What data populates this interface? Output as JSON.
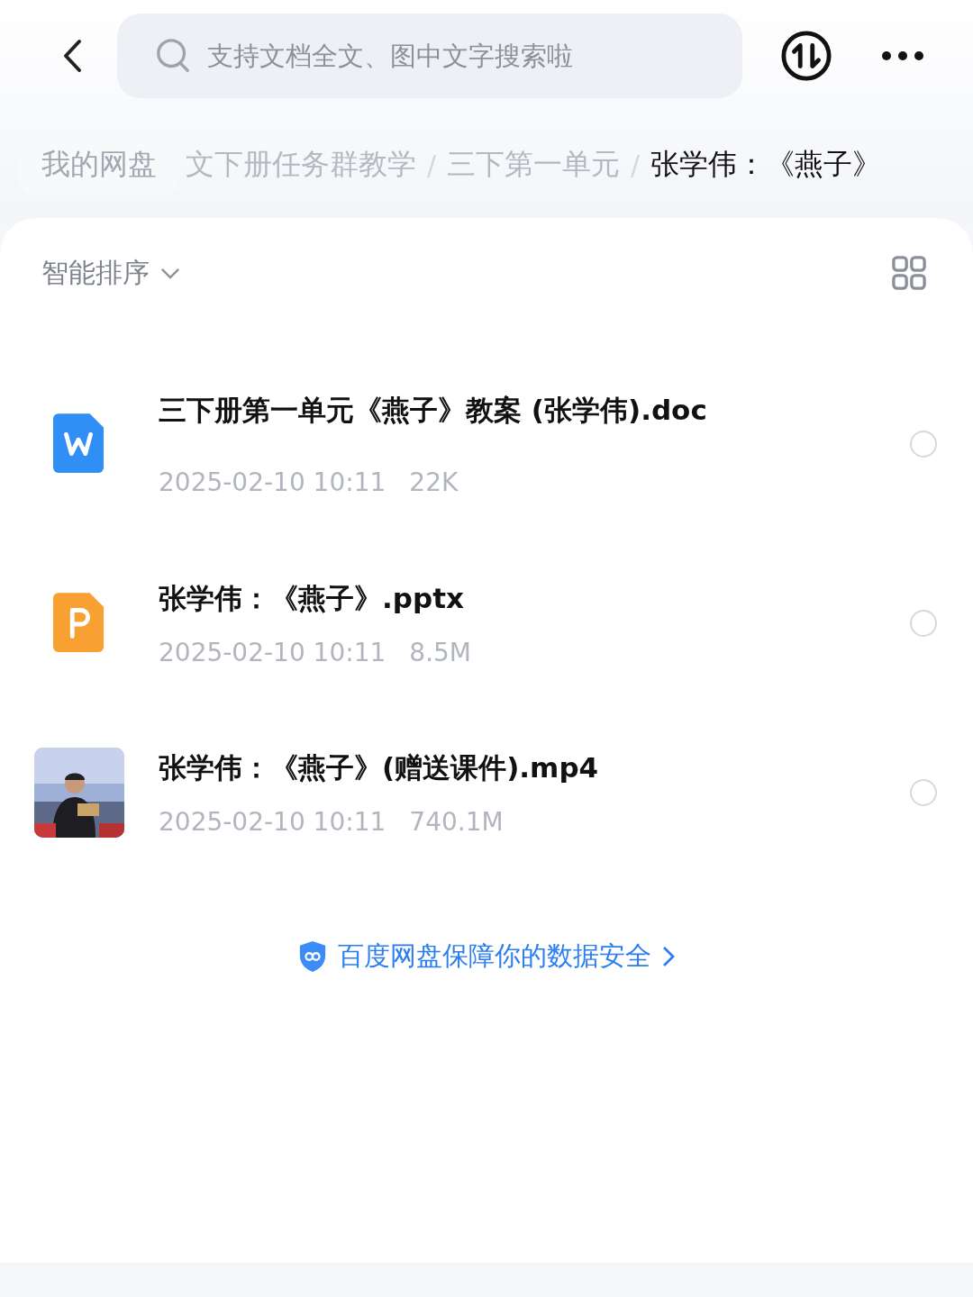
{
  "search": {
    "placeholder": "支持文档全文、图中文字搜索啦"
  },
  "breadcrumbs": [
    {
      "label": "我的网盘",
      "current": false
    },
    {
      "label": "文下册任务群教学",
      "current": false
    },
    {
      "label": "三下第一单元",
      "current": false
    },
    {
      "label": "张学伟：《燕子》",
      "current": true
    }
  ],
  "breadcrumb_separator": "/",
  "sort": {
    "label": "智能排序"
  },
  "files": [
    {
      "kind": "doc",
      "name": "三下册第一单元《燕子》教案 (张学伟).doc",
      "date": "2025-02-10 10:11",
      "size": "22K",
      "selected": false
    },
    {
      "kind": "ppt",
      "name": "张学伟：《燕子》.pptx",
      "date": "2025-02-10 10:11",
      "size": "8.5M",
      "selected": false
    },
    {
      "kind": "video",
      "name": "张学伟：《燕子》(赠送课件).mp4",
      "date": "2025-02-10 10:11",
      "size": "740.1M",
      "selected": false
    }
  ],
  "footer": {
    "text": "百度网盘保障你的数据安全"
  }
}
